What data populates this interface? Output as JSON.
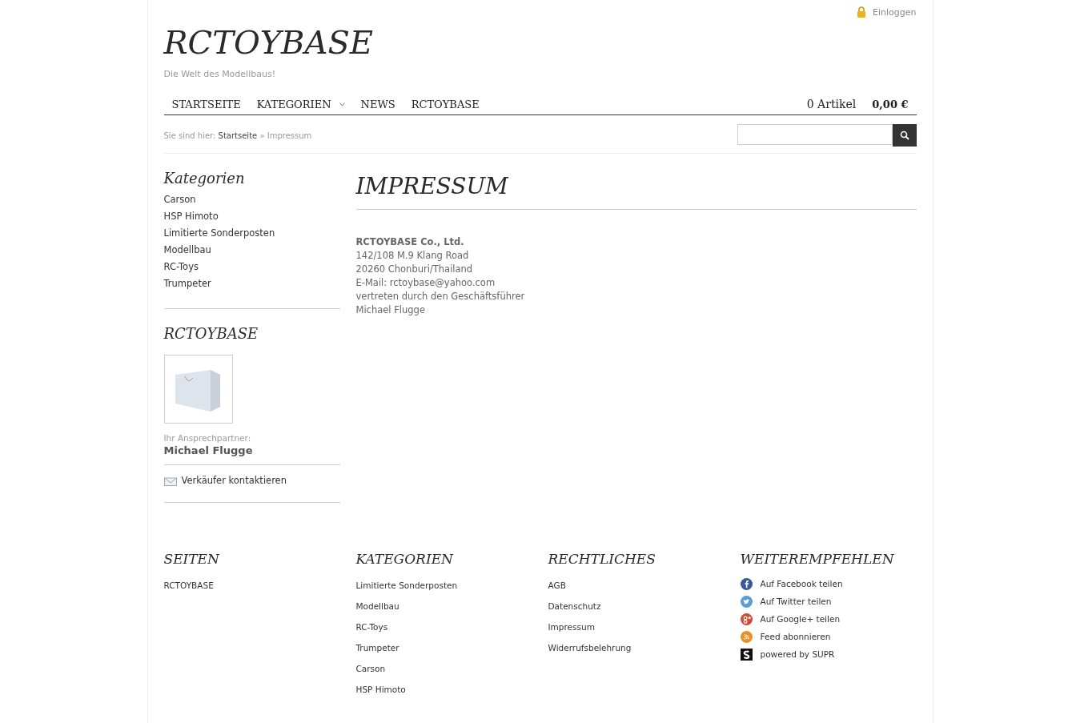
{
  "login": {
    "label": "Einloggen"
  },
  "brand": {
    "title": "RCTOYBASE",
    "tagline": "Die Welt des Modellbaus!"
  },
  "nav": [
    {
      "label": "STARTSEITE",
      "dropdown": false
    },
    {
      "label": "KATEGORIEN",
      "dropdown": true
    },
    {
      "label": "NEWS",
      "dropdown": false
    },
    {
      "label": "RCTOYBASE",
      "dropdown": false
    }
  ],
  "cart": {
    "count": "0 Artikel",
    "total": "0,00 €"
  },
  "breadcrumb": {
    "prefix": "Sie sind hier:",
    "link": "Startseite",
    "separator": "»",
    "current": "Impressum"
  },
  "sidebar": {
    "categories_title": "Kategorien",
    "categories": [
      "Carson",
      "HSP Himoto",
      "Limitierte Sonderposten",
      "Modellbau",
      "RC-Toys",
      "Trumpeter"
    ],
    "shop_title": "RCTOYBASE",
    "contact_label": "Ihr Ansprechpartner:",
    "contact_name": "Michael Flugge",
    "contact_link": "Verkäufer kontaktieren"
  },
  "content": {
    "title": "IMPRESSUM",
    "company": "RCTOYBASE Co., Ltd.",
    "lines": [
      "142/108 M.9 Klang Road",
      "20260 Chonburi/Thailand",
      "E-Mail: rctoybase@yahoo.com",
      "vertreten durch den Geschäftsführer",
      "Michael Flugge"
    ]
  },
  "footer": {
    "columns": [
      {
        "title": "SEITEN",
        "links": [
          "RCTOYBASE"
        ]
      },
      {
        "title": "KATEGORIEN",
        "links": [
          "Limitierte Sonderposten",
          "Modellbau",
          "RC-Toys",
          "Trumpeter",
          "Carson",
          "HSP Himoto"
        ]
      },
      {
        "title": "RECHTLICHES",
        "links": [
          "AGB",
          "Datenschutz",
          "Impressum",
          "Widerrufsbelehrung"
        ]
      }
    ],
    "share": {
      "title": "WEITEREMPFEHLEN",
      "items": [
        {
          "kind": "facebook",
          "label": "Auf Facebook teilen"
        },
        {
          "kind": "twitter",
          "label": "Auf Twitter teilen"
        },
        {
          "kind": "google",
          "label": "Auf Google+ teilen"
        },
        {
          "kind": "rss",
          "label": "Feed abonnieren"
        },
        {
          "kind": "supr",
          "label": "powered by SUPR"
        }
      ]
    }
  }
}
